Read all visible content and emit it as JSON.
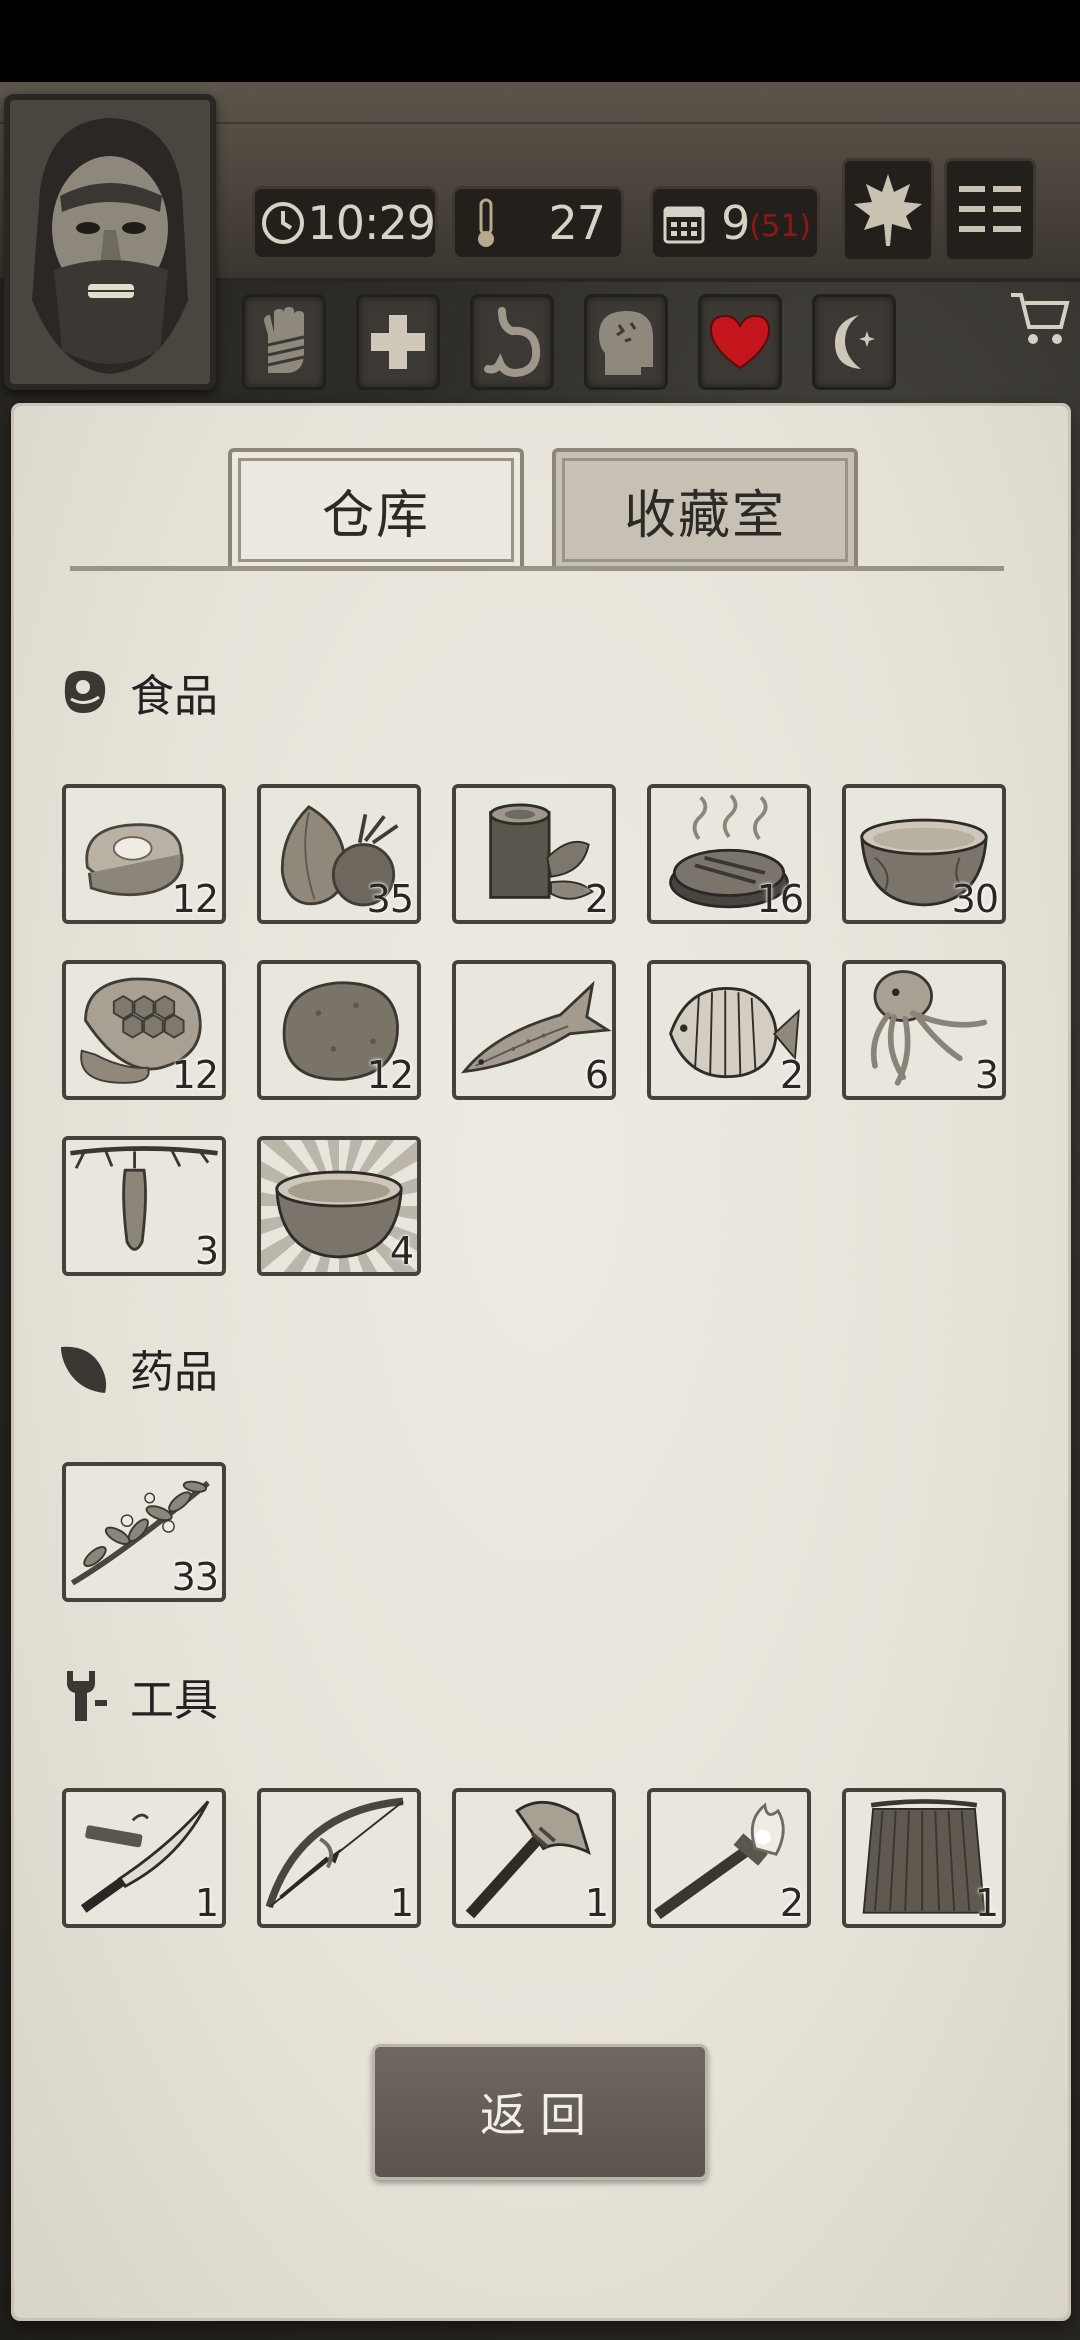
{
  "hud": {
    "time": "10:29",
    "temperature": "27",
    "day": "9",
    "day_sub": "(51)"
  },
  "status_icons": [
    "hand-bandage-icon",
    "health-cross-icon",
    "stomach-icon",
    "head-mind-icon",
    "heart-icon",
    "moon-icon"
  ],
  "tabs": [
    {
      "label": "仓库",
      "active": true
    },
    {
      "label": "收藏室",
      "active": false
    }
  ],
  "sections": {
    "food": {
      "title": "食品",
      "items": [
        {
          "icon": "raw-meat-icon",
          "count": "12"
        },
        {
          "icon": "coconut-icon",
          "count": "35"
        },
        {
          "icon": "log-herb-icon",
          "count": "2"
        },
        {
          "icon": "cooked-meat-icon",
          "count": "16"
        },
        {
          "icon": "coconut-soup-bowl-icon",
          "count": "30"
        },
        {
          "icon": "honeycomb-icon",
          "count": "12"
        },
        {
          "icon": "potato-icon",
          "count": "12"
        },
        {
          "icon": "fish-icon",
          "count": "6"
        },
        {
          "icon": "tropical-fish-icon",
          "count": "2"
        },
        {
          "icon": "squid-icon",
          "count": "3"
        },
        {
          "icon": "hanging-fruit-icon",
          "count": "3"
        },
        {
          "icon": "special-bowl-icon",
          "count": "4"
        }
      ]
    },
    "medicine": {
      "title": "药品",
      "items": [
        {
          "icon": "herb-branch-icon",
          "count": "33"
        }
      ]
    },
    "tools": {
      "title": "工具",
      "items": [
        {
          "icon": "machete-icon",
          "count": "1"
        },
        {
          "icon": "bow-icon",
          "count": "1"
        },
        {
          "icon": "stone-axe-icon",
          "count": "1"
        },
        {
          "icon": "torch-icon",
          "count": "2"
        },
        {
          "icon": "grass-skirt-icon",
          "count": "1"
        }
      ]
    }
  },
  "back_button": "返回",
  "colors": {
    "paper": "#e6e2d8",
    "slot_border": "#45413b",
    "button": "#5f5850",
    "heart": "#c3151b",
    "day_sub": "#8c1818"
  }
}
